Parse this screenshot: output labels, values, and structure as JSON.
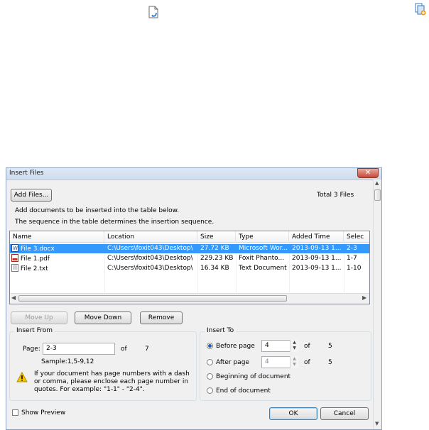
{
  "top_icons": {
    "left_icon": "document-arrow-icon",
    "right_icon": "insert-file-icon"
  },
  "dialog": {
    "title": "Insert Files",
    "close_glyph": "✕",
    "add_files_label": "Add Files...",
    "total_label": "Total 3 Files",
    "instruction_1": "Add documents to be inserted into the table below.",
    "instruction_2": "The sequence in the table determines the insertion sequence.",
    "columns": [
      "Name",
      "Location",
      "Size",
      "Type",
      "Added Time",
      "Selec"
    ],
    "rows": [
      {
        "name": "File 3.docx",
        "location": "C:\\Users\\foxit043\\Desktop\\",
        "size": "27.72 KB",
        "type": "Microsoft Wor...",
        "added": "2013-09-13 1...",
        "selection": "2-3",
        "selected": true,
        "icon": "word-doc-icon"
      },
      {
        "name": "File 1.pdf",
        "location": "C:\\Users\\foxit043\\Desktop\\",
        "size": "229.23 KB",
        "type": "Foxit Phanto...",
        "added": "2013-09-13 1...",
        "selection": "1-7",
        "selected": false,
        "icon": "pdf-icon"
      },
      {
        "name": "File 2.txt",
        "location": "C:\\Users\\foxit043\\Desktop\\",
        "size": "16.34 KB",
        "type": "Text Document",
        "added": "2013-09-13 1...",
        "selection": "1-10",
        "selected": false,
        "icon": "text-file-icon"
      }
    ],
    "move_up_label": "Move Up",
    "move_down_label": "Move Down",
    "remove_label": "Remove",
    "insert_from": {
      "legend": "Insert From",
      "page_label": "Page:",
      "page_value": "2-3",
      "of_label": "of",
      "total_pages": "7",
      "sample": "Sample:1,5-9,12",
      "warning": "If your document has page numbers with a dash or comma, please enclose each page number in quotes. For example: \"1-1\" - \"2-4\"."
    },
    "insert_to": {
      "legend": "Insert To",
      "before_label": "Before page",
      "before_value": "4",
      "after_label": "After page",
      "after_value": "4",
      "of_label": "of",
      "total_before": "5",
      "total_after": "5",
      "beginning_label": "Beginning of document",
      "end_label": "End of document",
      "selected": "before"
    },
    "show_preview_label": "Show Preview",
    "ok_label": "OK",
    "cancel_label": "Cancel",
    "colors": {
      "selection": "#3399ff",
      "warning": "#f5c400"
    }
  }
}
